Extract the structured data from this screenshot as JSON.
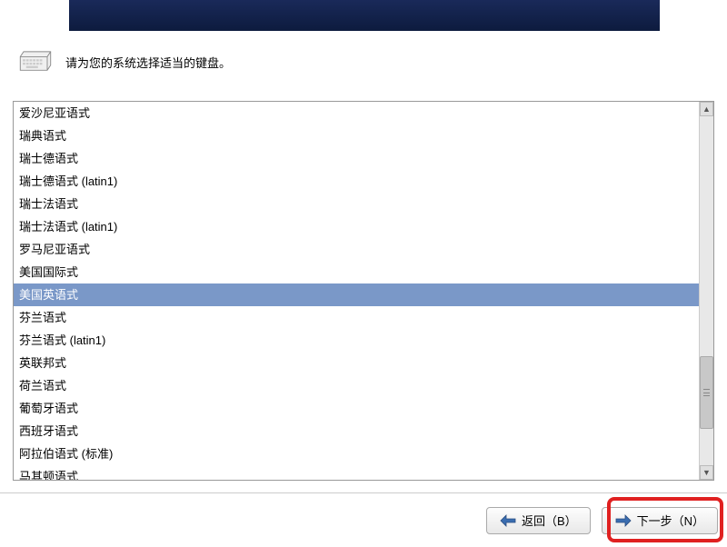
{
  "instruction": "请为您的系统选择适当的键盘。",
  "keyboard_layouts": [
    "爱沙尼亚语式",
    "瑞典语式",
    "瑞士德语式",
    "瑞士德语式 (latin1)",
    "瑞士法语式",
    "瑞士法语式 (latin1)",
    "罗马尼亚语式",
    "美国国际式",
    "美国英语式",
    "芬兰语式",
    "芬兰语式 (latin1)",
    "英联邦式",
    "荷兰语式",
    "葡萄牙语式",
    "西班牙语式",
    "阿拉伯语式 (标准)",
    "马其顿语式"
  ],
  "selected_index": 8,
  "buttons": {
    "back": "返回（B）",
    "next": "下一步（N）"
  }
}
